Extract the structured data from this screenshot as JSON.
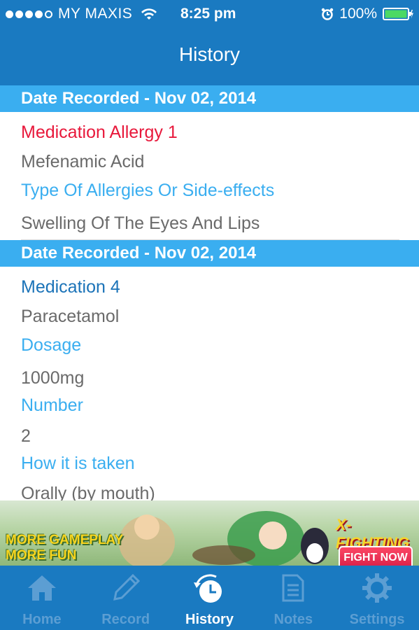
{
  "status": {
    "carrier": "MY MAXIS",
    "time": "8:25 pm",
    "battery": "100%"
  },
  "header": {
    "title": "History"
  },
  "records": [
    {
      "date_header": "Date Recorded - Nov 02, 2014",
      "title": "Medication Allergy 1",
      "title_color": "#e8183b",
      "name": "Mefenamic Acid",
      "fields": [
        {
          "label": "Type Of Allergies Or Side-effects",
          "value": "Swelling Of The Eyes And Lips"
        }
      ]
    },
    {
      "date_header": "Date Recorded - Nov 02, 2014",
      "title": "Medication 4",
      "title_color": "#1b73b8",
      "name": "Paracetamol",
      "fields": [
        {
          "label": "Dosage",
          "value": "1000mg"
        },
        {
          "label": "Number",
          "value": "2"
        },
        {
          "label": "How it is taken",
          "value": "Orally (by mouth)"
        }
      ]
    }
  ],
  "ad": {
    "left_line1": "MORE GAMEPLAY",
    "left_line2": "MORE FUN",
    "brand": "X-FIGHTING",
    "button": "FIGHT NOW"
  },
  "tabs": [
    {
      "label": "Home",
      "icon": "home-icon",
      "active": false
    },
    {
      "label": "Record",
      "icon": "pencil-icon",
      "active": false
    },
    {
      "label": "History",
      "icon": "clock-history-icon",
      "active": true
    },
    {
      "label": "Notes",
      "icon": "notes-icon",
      "active": false
    },
    {
      "label": "Settings",
      "icon": "gear-icon",
      "active": false
    }
  ],
  "colors": {
    "header_bg": "#1a7ac1",
    "section_bg": "#3aaef0",
    "label": "#3aaef0",
    "value": "#6a6a6a",
    "tab_inactive": "#5c9ed3",
    "tab_active": "#ffffff"
  }
}
